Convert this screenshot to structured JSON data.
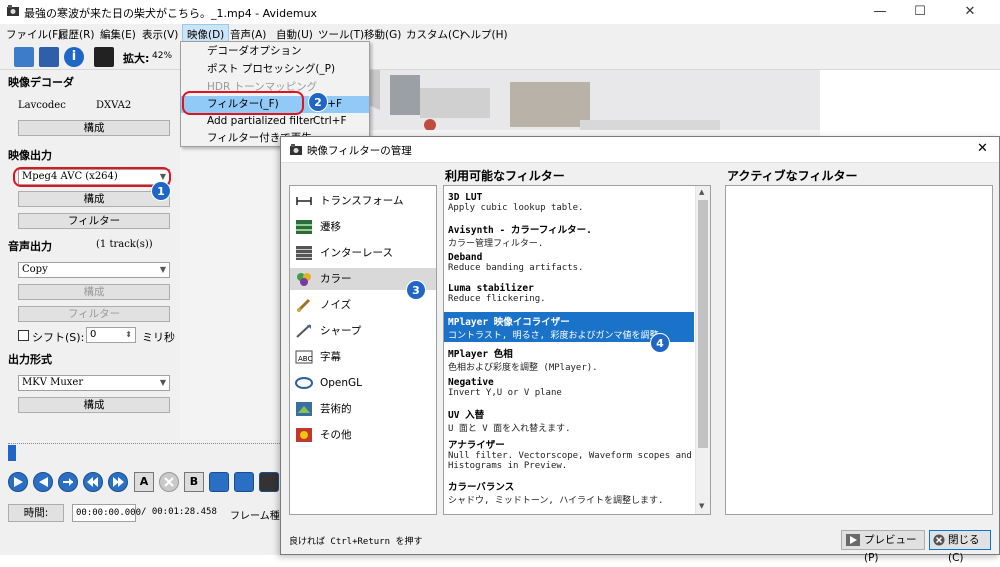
{
  "window": {
    "title": "最強の寒波が来た日の柴犬がこちら。_1.mp4 - Avidemux",
    "minimize": "—",
    "maximize": "☐",
    "close": "✕"
  },
  "menubar": [
    "ファイル(F)",
    "履歴(R)",
    "編集(E)",
    "表示(V)",
    "映像(D)",
    "音声(A)",
    "自動(U)",
    "ツール(T)",
    "移動(G)",
    "カスタム(C)",
    "ヘルプ(H)"
  ],
  "toolbar": {
    "zoom_label": "拡大:",
    "zoom_value": "42%"
  },
  "left_panel": {
    "video_decoder": {
      "heading": "映像デコーダ",
      "decoder_name": "Lavcodec",
      "decoder_value": "DXVA2",
      "configure_label": "構成"
    },
    "video_output": {
      "heading": "映像出力",
      "codec": "Mpeg4 AVC (x264)",
      "configure_label": "構成",
      "filters_label": "フィルター"
    },
    "audio_output": {
      "heading": "音声出力",
      "tracks": "(1 track(s))",
      "codec": "Copy",
      "configure_label": "構成",
      "filters_label": "フィルター",
      "shift_label": "シフト(S):",
      "shift_value": "0",
      "shift_unit": "ミリ秒"
    },
    "output_format": {
      "heading": "出力形式",
      "muxer": "MKV Muxer",
      "configure_label": "構成"
    }
  },
  "bottom": {
    "time_label": "時間:",
    "current_time": "00:00:00.000",
    "duration": "/ 00:01:28.458",
    "frame_type_label": "フレーム種類"
  },
  "video_menu": {
    "items": [
      {
        "label": "デコーダオプション",
        "shortcut": "",
        "disabled": false
      },
      {
        "label": "ポスト プロセッシング(_P)",
        "shortcut": "",
        "disabled": false
      },
      {
        "label": "HDR トーンマッピング",
        "shortcut": "",
        "disabled": true
      },
      {
        "label": "フィルター(_F)",
        "shortcut": "Alt+F",
        "disabled": false
      },
      {
        "label": "Add partialized filter",
        "shortcut": "Ctrl+F",
        "disabled": false
      },
      {
        "label": "フィルター付きで再生",
        "shortcut": "",
        "disabled": false
      }
    ]
  },
  "callouts": [
    "1",
    "2",
    "3",
    "4"
  ],
  "dialog": {
    "title": "映像フィルターの管理",
    "close": "✕",
    "available_heading": "利用可能なフィルター",
    "active_heading": "アクティブなフィルター",
    "categories": [
      {
        "label": "トランスフォーム",
        "icon": "transform-icon"
      },
      {
        "label": "遷移",
        "icon": "transition-icon"
      },
      {
        "label": "インターレース",
        "icon": "interlace-icon"
      },
      {
        "label": "カラー",
        "icon": "color-icon"
      },
      {
        "label": "ノイズ",
        "icon": "noise-icon"
      },
      {
        "label": "シャープ",
        "icon": "sharpen-icon"
      },
      {
        "label": "字幕",
        "icon": "subtitle-icon"
      },
      {
        "label": "OpenGL",
        "icon": "opengl-icon"
      },
      {
        "label": "芸術的",
        "icon": "artistic-icon"
      },
      {
        "label": "その他",
        "icon": "misc-icon"
      }
    ],
    "selected_category": "カラー",
    "filters": [
      {
        "name": "3D LUT",
        "desc": [
          "Apply cubic lookup table."
        ]
      },
      {
        "name": "Avisynth - カラーフィルター.",
        "desc": [
          "カラー管理フィルター."
        ]
      },
      {
        "name": "Deband",
        "desc": [
          "Reduce banding artifacts."
        ]
      },
      {
        "name": "Luma stabilizer",
        "desc": [
          "Reduce flickering."
        ]
      },
      {
        "name": "MPlayer 映像イコライザー",
        "desc": [
          "コントラスト, 明るさ, 彩度およびガンマ値を調整."
        ]
      },
      {
        "name": "MPlayer 色相",
        "desc": [
          "色相および彩度を調整 (MPlayer)."
        ]
      },
      {
        "name": "Negative",
        "desc": [
          "Invert Y,U or V plane"
        ]
      },
      {
        "name": "UV 入替",
        "desc": [
          "U 面と V 面を入れ替えます."
        ]
      },
      {
        "name": "アナライザー",
        "desc": [
          "Null filter. Vectorscope, Waveform scopes and",
          "Histograms in Preview."
        ]
      },
      {
        "name": "カラーバランス",
        "desc": [
          "シャドウ, ミッドトーン, ハイライトを調整します."
        ]
      }
    ],
    "selected_filter": "MPlayer 映像イコライザー",
    "hint": "良ければ Ctrl+Return を押す",
    "preview_label": "プレビュー(P)",
    "close_label": "閉じる(C)"
  }
}
